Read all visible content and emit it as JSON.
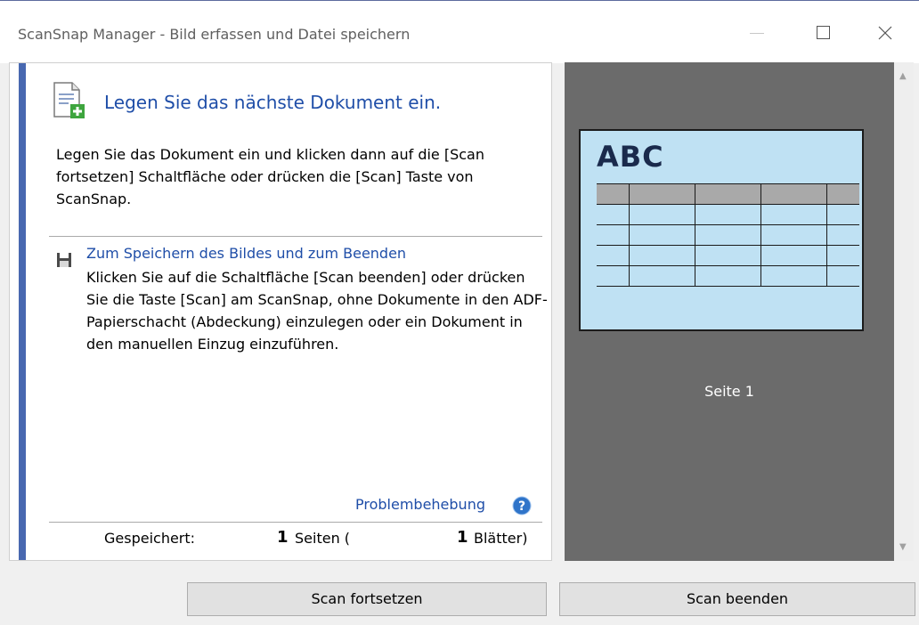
{
  "window": {
    "title": "ScanSnap Manager - Bild erfassen und Datei speichern",
    "controls": [
      "minimize-icon",
      "maximize-icon",
      "close-icon"
    ]
  },
  "main": {
    "heading": "Legen Sie das nächste Dokument ein.",
    "instruction": "Legen Sie das Dokument ein und klicken dann auf die [Scan fortsetzen] Schaltfläche oder drücken die [Scan] Taste von ScanSnap.",
    "save_title": "Zum Speichern des Bildes und zum Beenden",
    "save_text": "Klicken Sie auf die Schaltfläche [Scan beenden] oder drücken Sie die Taste [Scan] am ScanSnap, ohne Dokumente in den ADF-Papierschacht (Abdeckung) einzulegen oder ein Dokument in den manuellen Einzug einzuführen.",
    "troubleshooting": "Problembehebung",
    "status": {
      "label": "Gespeichert:",
      "pages": "1",
      "pages_unit": "Seiten (",
      "sheets": "1",
      "sheets_unit": "Blätter)"
    }
  },
  "preview": {
    "thumb_text": "ABC",
    "page_label": "Seite 1"
  },
  "buttons": {
    "continue": "Scan fortsetzen",
    "finish": "Scan beenden"
  },
  "colors": {
    "accent": "#4868b0",
    "link": "#1f4ea8",
    "preview_bg": "#6b6b6b",
    "thumb_bg": "#bfe1f3"
  }
}
